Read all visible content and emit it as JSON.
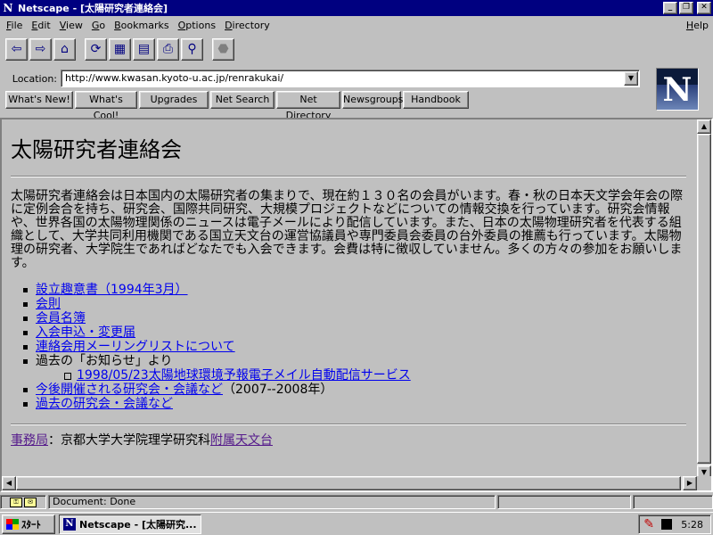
{
  "window": {
    "title": "Netscape - [太陽研究者連絡会]",
    "app_icon": "N",
    "controls": [
      "_",
      "▫",
      "×"
    ]
  },
  "menu": {
    "items": [
      {
        "label": "File",
        "mnemonic": "F",
        "rest": "ile"
      },
      {
        "label": "Edit",
        "mnemonic": "E",
        "rest": "dit"
      },
      {
        "label": "View",
        "mnemonic": "V",
        "rest": "iew"
      },
      {
        "label": "Go",
        "mnemonic": "G",
        "rest": "o"
      },
      {
        "label": "Bookmarks",
        "mnemonic": "B",
        "rest": "ookmarks"
      },
      {
        "label": "Options",
        "mnemonic": "O",
        "rest": "ptions"
      },
      {
        "label": "Directory",
        "mnemonic": "D",
        "rest": "irectory"
      }
    ],
    "help": {
      "label": "Help",
      "mnemonic": "H",
      "rest": "elp"
    }
  },
  "toolbar": {
    "buttons": [
      {
        "icon": "back-arrow-icon",
        "glyph": "⇦"
      },
      {
        "icon": "forward-arrow-icon",
        "glyph": "⇨"
      },
      {
        "icon": "home-icon",
        "glyph": "⌂"
      },
      {
        "icon": "reload-icon",
        "glyph": "⟳"
      },
      {
        "icon": "images-icon",
        "glyph": "▦"
      },
      {
        "icon": "open-icon",
        "glyph": "▤"
      },
      {
        "icon": "print-icon",
        "glyph": "⎙"
      },
      {
        "icon": "find-icon",
        "glyph": "⚲"
      },
      {
        "icon": "stop-icon",
        "glyph": "⬣"
      }
    ]
  },
  "location": {
    "label": "Location:",
    "url": "http://www.kwasan.kyoto-u.ac.jp/renrakukai/"
  },
  "directory_buttons": [
    {
      "label": "What's New!",
      "width": 76
    },
    {
      "label": "What's Cool!",
      "width": 70
    },
    {
      "label": "Upgrades",
      "width": 78
    },
    {
      "label": "Net Search",
      "width": 72
    },
    {
      "label": "Net Directory",
      "width": 70
    },
    {
      "label": "Newsgroups",
      "width": 64
    },
    {
      "label": "Handbook",
      "width": 74
    }
  ],
  "logo": {
    "letter": "N"
  },
  "page": {
    "title": "太陽研究者連絡会",
    "intro": "太陽研究者連絡会は日本国内の太陽研究者の集まりで、現在約１３０名の会員がいます。春・秋の日本天文学会年会の際に定例会合を持ち、研究会、国際共同研究、大規模プロジェクトなどについての情報交換を行っています。研究会情報や、世界各国の太陽物理関係のニュースは電子メールにより配信しています。また、日本の太陽物理研究者を代表する組織として、大学共同利用機関である国立天文台の運営協議員や専門委員会委員の台外委員の推薦も行っています。太陽物理の研究者、大学院生であればどなたでも入会できます。会費は特に徴収していません。多くの方々の参加をお願いします。",
    "links": [
      {
        "text": "設立趣意書（1994年3月）",
        "suffix": ""
      },
      {
        "text": "会則",
        "suffix": ""
      },
      {
        "text": "会員名簿",
        "suffix": ""
      },
      {
        "text": "入会申込・変更届",
        "suffix": ""
      },
      {
        "text": "連絡会用メーリングリストについて",
        "suffix": ""
      }
    ],
    "past_notices_label": "過去の「お知らせ」より",
    "sub_link": "1998/05/23太陽地球環境予報電子メイル自動配信サービス",
    "links2": [
      {
        "text": "今後開催される研究会・会議など",
        "suffix": "（2007--2008年）"
      },
      {
        "text": "過去の研究会・会議など",
        "suffix": ""
      }
    ],
    "footer": {
      "link1": "事務局",
      "middle": "：京都大学大学院理学研究科",
      "link2": "附属天文台"
    }
  },
  "status": {
    "text": "Document: Done"
  },
  "taskbar": {
    "start_label": "ｽﾀｰﾄ",
    "task_label": "Netscape - [太陽研究...",
    "clock": "5:28"
  }
}
